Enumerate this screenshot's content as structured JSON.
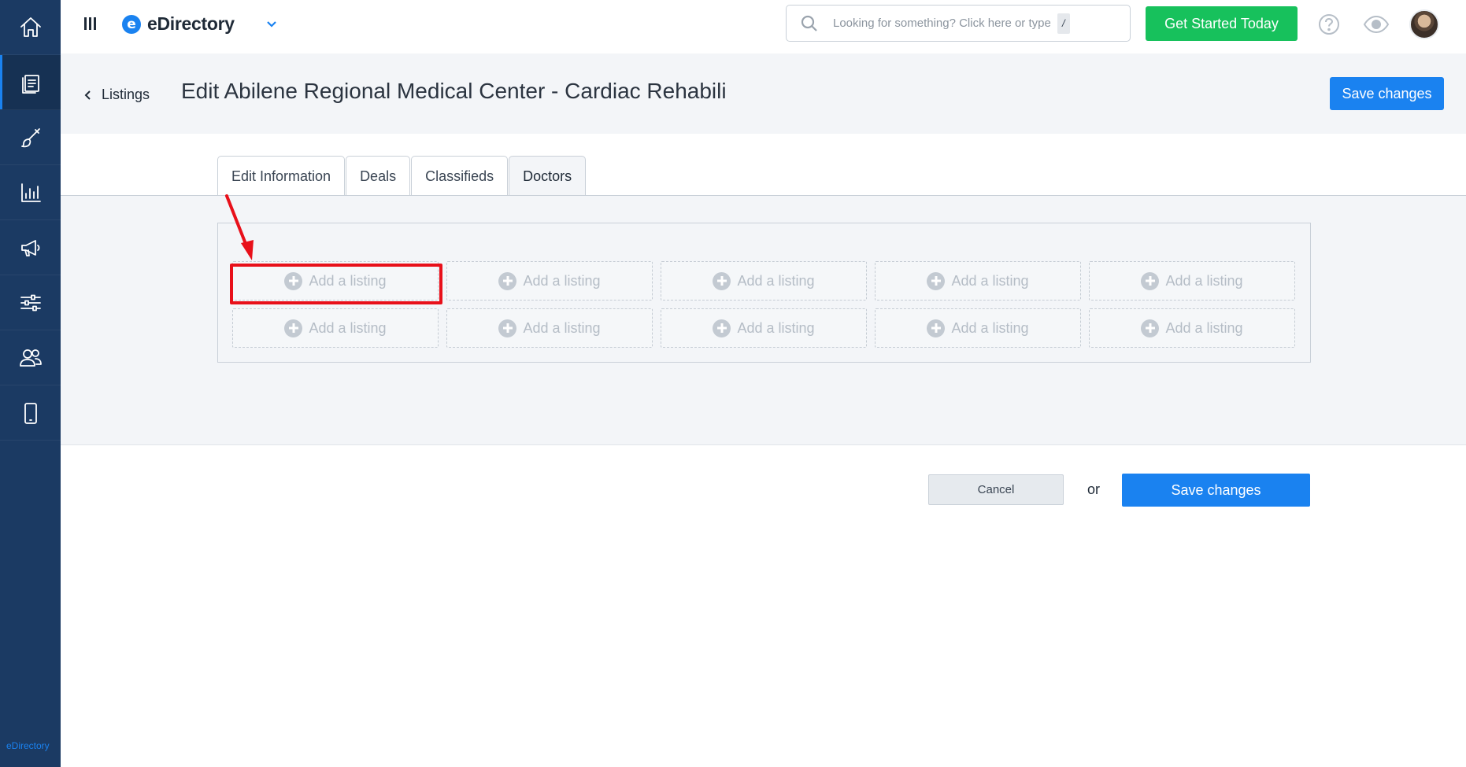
{
  "app": {
    "name": "eDirectory",
    "footer_brand": "eDirectory"
  },
  "sidebar": {
    "items": [
      {
        "icon": "home-icon",
        "label": "Home",
        "active": false
      },
      {
        "icon": "content-icon",
        "label": "Content",
        "active": true
      },
      {
        "icon": "design-brush-icon",
        "label": "Design",
        "active": false
      },
      {
        "icon": "reports-chart-icon",
        "label": "Reports",
        "active": false
      },
      {
        "icon": "promote-megaphone-icon",
        "label": "Promote",
        "active": false
      },
      {
        "icon": "settings-sliders-icon",
        "label": "Settings",
        "active": false
      },
      {
        "icon": "users-icon",
        "label": "Users",
        "active": false
      },
      {
        "icon": "mobile-icon",
        "label": "Mobile",
        "active": false
      }
    ]
  },
  "topbar": {
    "search": {
      "placeholder": "Looking for something? Click here or type",
      "shortcut_key": "/"
    },
    "cta_label": "Get Started Today",
    "help_icon": "help-circle-icon",
    "preview_icon": "eye-icon"
  },
  "header": {
    "breadcrumb": "Listings",
    "title": "Edit Abilene Regional Medical Center - Cardiac Rehabili",
    "save_label": "Save changes"
  },
  "tabs": [
    {
      "label": "Edit Information",
      "active": false
    },
    {
      "label": "Deals",
      "active": false
    },
    {
      "label": "Classifieds",
      "active": false
    },
    {
      "label": "Doctors",
      "active": true
    }
  ],
  "doctors": {
    "slot_label": "Add a listing",
    "slots": [
      "Add a listing",
      "Add a listing",
      "Add a listing",
      "Add a listing",
      "Add a listing",
      "Add a listing",
      "Add a listing",
      "Add a listing",
      "Add a listing",
      "Add a listing"
    ]
  },
  "footer": {
    "cancel_label": "Cancel",
    "or_label": "or",
    "save_label": "Save changes"
  },
  "colors": {
    "sidebar": "#1b3a63",
    "primary": "#1a82f0",
    "cta": "#17c15c",
    "annotation": "#e8101a",
    "background_band": "#f3f5f8"
  }
}
